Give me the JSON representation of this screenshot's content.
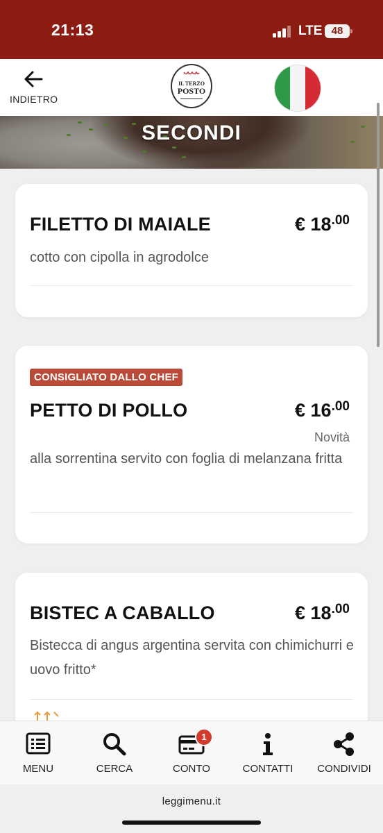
{
  "status_bar": {
    "time": "21:13",
    "network": "LTE",
    "battery": "48"
  },
  "header": {
    "back_label": "INDIETRO",
    "logo": {
      "line1": "IL TERZO",
      "line2": "POSTO"
    },
    "language": "Italiano"
  },
  "section": {
    "title": "SECONDI"
  },
  "dishes": [
    {
      "name": "FILETTO DI MAIALE",
      "price_main": "€ 18",
      "price_cents": ".00",
      "description": "cotto con cipolla in agrodolce"
    },
    {
      "badge": "CONSIGLIATO DALLO CHEF",
      "name": "PETTO DI POLLO",
      "price_main": "€ 16",
      "price_cents": ".00",
      "tag": "Novità",
      "description": "alla sorrentina servito con foglia di melanzana fritta"
    },
    {
      "name": "BISTEC A CABALLO",
      "price_main": "€ 18",
      "price_cents": ".00",
      "description": "Bistecca di angus argentina servita con chimichurri e uovo fritto*"
    }
  ],
  "bottom_nav": [
    {
      "label": "MENU",
      "icon": "list-icon"
    },
    {
      "label": "CERCA",
      "icon": "search-icon"
    },
    {
      "label": "CONTO",
      "icon": "card-icon",
      "badge": "1"
    },
    {
      "label": "CONTATTI",
      "icon": "info-icon"
    },
    {
      "label": "CONDIVIDI",
      "icon": "share-icon"
    }
  ],
  "footer": {
    "text": "leggimenu.it"
  },
  "colors": {
    "brand_red": "#8c1b12",
    "badge_red": "#b84a37",
    "notification_red": "#d33a2c"
  }
}
